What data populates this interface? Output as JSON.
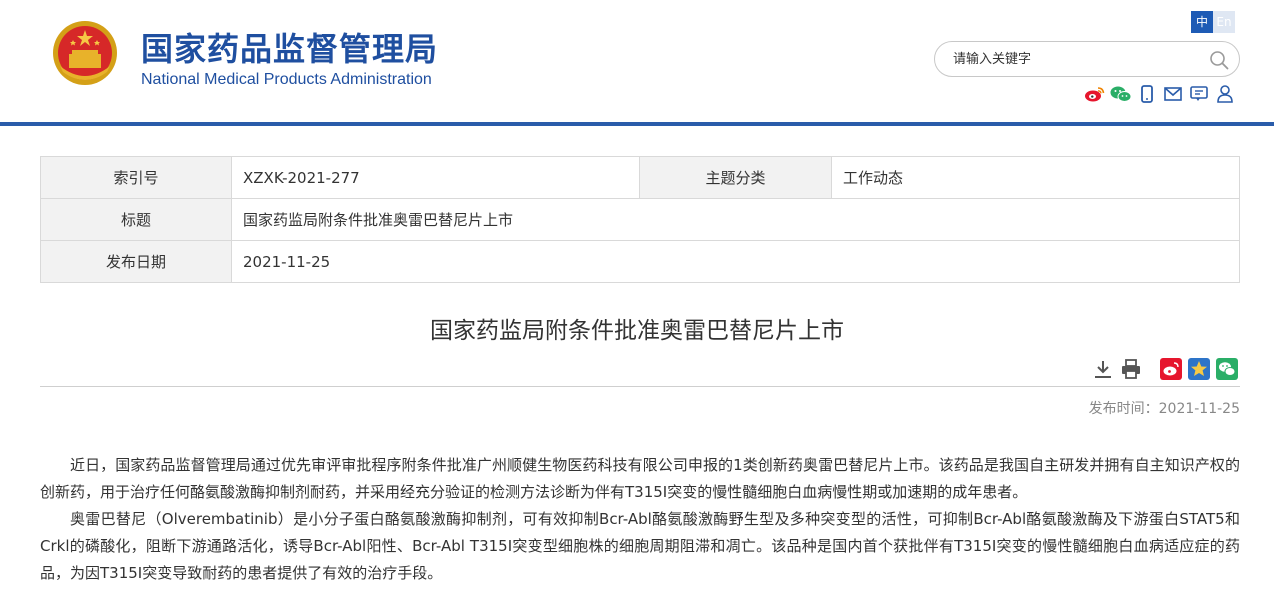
{
  "header": {
    "title_cn": "国家药品监督管理局",
    "title_en": "National Medical Products Administration",
    "lang_zh": "中",
    "lang_en": "En",
    "search_placeholder": "请输入关键字"
  },
  "info": {
    "index_label": "索引号",
    "index_value": "XZXK-2021-277",
    "topic_label": "主题分类",
    "topic_value": "工作动态",
    "title_label": "标题",
    "title_value": "国家药监局附条件批准奥雷巴替尼片上市",
    "date_label": "发布日期",
    "date_value": "2021-11-25"
  },
  "article": {
    "title": "国家药监局附条件批准奥雷巴替尼片上市",
    "pubdate": "发布时间：2021-11-25",
    "p1": "近日，国家药品监督管理局通过优先审评审批程序附条件批准广州顺健生物医药科技有限公司申报的1类创新药奥雷巴替尼片上市。该药品是我国自主研发并拥有自主知识产权的创新药，用于治疗任何酪氨酸激酶抑制剂耐药，并采用经充分验证的检测方法诊断为伴有T315I突变的慢性髓细胞白血病慢性期或加速期的成年患者。",
    "p2": "奥雷巴替尼（Olverembatinib）是小分子蛋白酪氨酸激酶抑制剂，可有效抑制Bcr-Abl酪氨酸激酶野生型及多种突变型的活性，可抑制Bcr-Abl酪氨酸激酶及下游蛋白STAT5和Crkl的磷酸化，阻断下游通路活化，诱导Bcr-Abl阳性、Bcr-Abl T315I突变型细胞株的细胞周期阻滞和凋亡。该品种是国内首个获批伴有T315I突变的慢性髓细胞白血病适应症的药品，为因T315I突变导致耐药的患者提供了有效的治疗手段。"
  },
  "colors": {
    "brand_blue": "#1f4fa0",
    "bar_blue": "#2a5caa",
    "weibo_red": "#e6162d",
    "wechat_green": "#2aae67"
  },
  "icons": [
    "national-emblem-icon",
    "search-icon",
    "weibo-icon",
    "wechat-icon",
    "mobile-icon",
    "mail-icon",
    "message-icon",
    "user-icon",
    "download-icon",
    "print-icon",
    "favorite-icon"
  ]
}
